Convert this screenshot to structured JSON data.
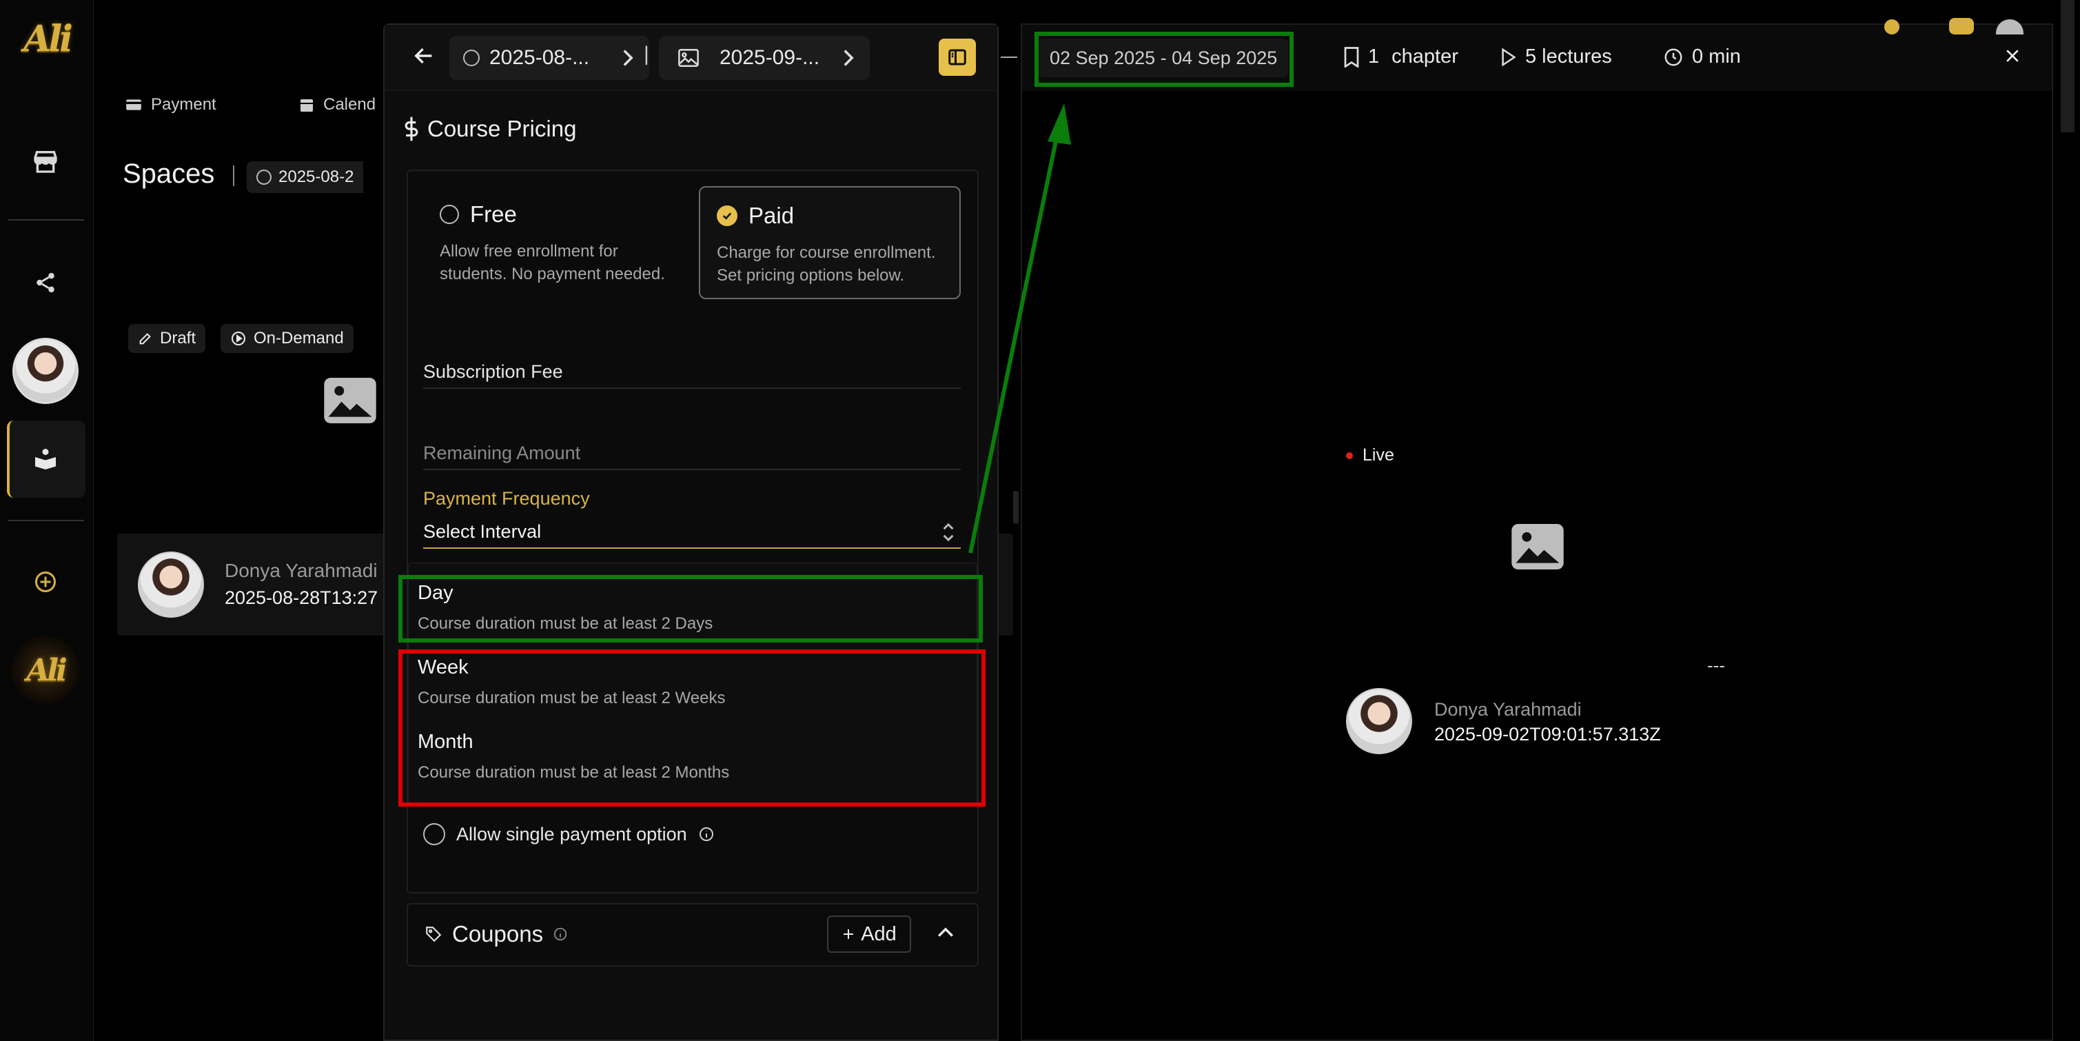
{
  "rail": {
    "logo_text": "Ali",
    "items": [
      "store-icon",
      "share-icon",
      "user-avatar",
      "course-icon",
      "add-icon",
      "brand-logo"
    ]
  },
  "background": {
    "nav": {
      "payment": "Payment",
      "calendar": "Calend"
    },
    "title": "Spaces",
    "date_chip": "2025-08-2",
    "badges": {
      "draft": "Draft",
      "on_demand": "On-Demand"
    },
    "author": {
      "name": "Donya Yarahmadi",
      "timestamp": "2025-08-28T13:27"
    }
  },
  "panel": {
    "header": {
      "chip1": "2025-08-...",
      "separator": "|",
      "chip2": "2025-09-..."
    },
    "section_title": "Course Pricing",
    "free": {
      "title": "Free",
      "desc1": "Allow free enrollment for",
      "desc2": "students. No payment needed."
    },
    "paid": {
      "title": "Paid",
      "desc1": "Charge for course enrollment.",
      "desc2": "Set pricing options below."
    },
    "subscription_fee": "Subscription Fee",
    "remaining_amount": "Remaining Amount",
    "payment_frequency": {
      "label": "Payment Frequency",
      "value": "Select Interval"
    },
    "options": [
      {
        "title": "Day",
        "desc": "Course duration must be at least 2 Days"
      },
      {
        "title": "Week",
        "desc": "Course duration must be at least 2 Weeks"
      },
      {
        "title": "Month",
        "desc": "Course duration must be at least 2 Months"
      }
    ],
    "single_payment": "Allow single payment option",
    "coupons": {
      "title": "Coupons",
      "add": "Add"
    }
  },
  "preview": {
    "date_range": "02 Sep 2025 - 04 Sep 2025",
    "chapters_count": "1",
    "chapters_label": "chapter",
    "lectures": "5 lectures",
    "duration": "0 min",
    "live": "Live",
    "dashes": "---",
    "author": {
      "name": "Donya Yarahmadi",
      "timestamp": "2025-09-02T09:01:57.313Z"
    }
  },
  "colors": {
    "accent": "#e6c04a",
    "highlight_green": "#0a7d0a",
    "highlight_red": "#e00000",
    "live_dot": "#e02020"
  }
}
